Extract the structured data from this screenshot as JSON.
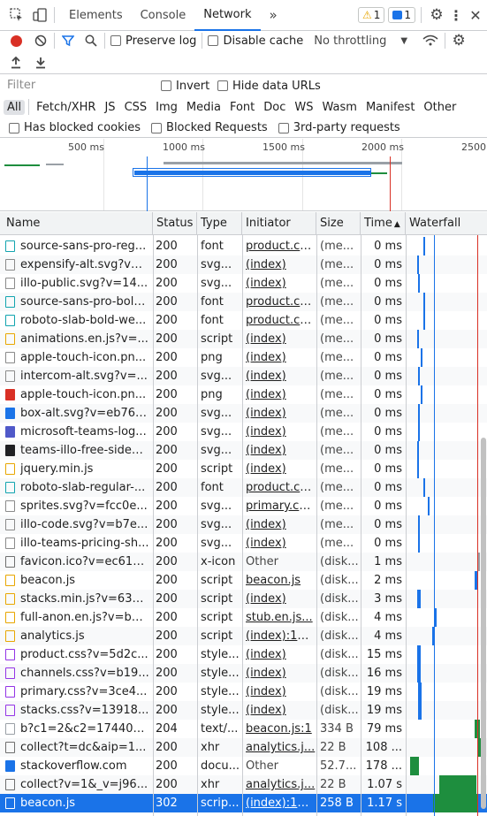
{
  "tabs": [
    "Elements",
    "Console",
    "Network"
  ],
  "more_tabs": "»",
  "warnings_count": "1",
  "messages_count": "1",
  "toolbar": {
    "preserve_log": "Preserve log",
    "disable_cache": "Disable cache",
    "throttling": "No throttling"
  },
  "filter": {
    "placeholder": "Filter",
    "invert": "Invert",
    "hide_data_urls": "Hide data URLs"
  },
  "type_filters": [
    "All",
    "Fetch/XHR",
    "JS",
    "CSS",
    "Img",
    "Media",
    "Font",
    "Doc",
    "WS",
    "Wasm",
    "Manifest",
    "Other"
  ],
  "options": {
    "blocked_cookies": "Has blocked cookies",
    "blocked_requests": "Blocked Requests",
    "third_party": "3rd-party requests"
  },
  "overview_ticks": [
    "500 ms",
    "1000 ms",
    "1500 ms",
    "2000 ms",
    "2500"
  ],
  "columns": {
    "name": "Name",
    "status": "Status",
    "type": "Type",
    "initiator": "Initiator",
    "size": "Size",
    "time": "Time",
    "waterfall": "Waterfall"
  },
  "rows": [
    {
      "name": "source-sans-pro-reg...",
      "status": "200",
      "type": "font",
      "initiator": "product.cs...",
      "size": "(me...",
      "time": "0 ms",
      "icon": "font"
    },
    {
      "name": "expensify-alt.svg?v=...",
      "status": "200",
      "type": "svg...",
      "initiator": "(index)",
      "size": "(me...",
      "time": "0 ms",
      "icon": "image"
    },
    {
      "name": "illo-public.svg?v=14...",
      "status": "200",
      "type": "svg...",
      "initiator": "(index)",
      "size": "(me...",
      "time": "0 ms",
      "icon": "image"
    },
    {
      "name": "source-sans-pro-bold...",
      "status": "200",
      "type": "font",
      "initiator": "product.cs...",
      "size": "(me...",
      "time": "0 ms",
      "icon": "font"
    },
    {
      "name": "roboto-slab-bold-we...",
      "status": "200",
      "type": "font",
      "initiator": "product.cs...",
      "size": "(me...",
      "time": "0 ms",
      "icon": "font"
    },
    {
      "name": "animations.en.js?v=...",
      "status": "200",
      "type": "script",
      "initiator": "(index)",
      "size": "(me...",
      "time": "0 ms",
      "icon": "script"
    },
    {
      "name": "apple-touch-icon.pn...",
      "status": "200",
      "type": "png",
      "initiator": "(index)",
      "size": "(me...",
      "time": "0 ms",
      "icon": "image"
    },
    {
      "name": "intercom-alt.svg?v=...",
      "status": "200",
      "type": "svg...",
      "initiator": "(index)",
      "size": "(me...",
      "time": "0 ms",
      "icon": "image"
    },
    {
      "name": "apple-touch-icon.pn...",
      "status": "200",
      "type": "png",
      "initiator": "(index)",
      "size": "(me...",
      "time": "0 ms",
      "icon": "red"
    },
    {
      "name": "box-alt.svg?v=eb76f...",
      "status": "200",
      "type": "svg...",
      "initiator": "(index)",
      "size": "(me...",
      "time": "0 ms",
      "icon": "box"
    },
    {
      "name": "microsoft-teams-log...",
      "status": "200",
      "type": "svg...",
      "initiator": "(index)",
      "size": "(me...",
      "time": "0 ms",
      "icon": "teams"
    },
    {
      "name": "teams-illo-free-sideb...",
      "status": "200",
      "type": "svg...",
      "initiator": "(index)",
      "size": "(me...",
      "time": "0 ms",
      "icon": "dark"
    },
    {
      "name": "jquery.min.js",
      "status": "200",
      "type": "script",
      "initiator": "(index)",
      "size": "(me...",
      "time": "0 ms",
      "icon": "script"
    },
    {
      "name": "roboto-slab-regular-...",
      "status": "200",
      "type": "font",
      "initiator": "product.cs...",
      "size": "(me...",
      "time": "0 ms",
      "icon": "font"
    },
    {
      "name": "sprites.svg?v=fcc0e...",
      "status": "200",
      "type": "svg...",
      "initiator": "primary.cs...",
      "size": "(me...",
      "time": "0 ms",
      "icon": "image"
    },
    {
      "name": "illo-code.svg?v=b7e...",
      "status": "200",
      "type": "svg...",
      "initiator": "(index)",
      "size": "(me...",
      "time": "0 ms",
      "icon": "image"
    },
    {
      "name": "illo-teams-pricing-sh...",
      "status": "200",
      "type": "svg...",
      "initiator": "(index)",
      "size": "(me...",
      "time": "0 ms",
      "icon": "image"
    },
    {
      "name": "favicon.ico?v=ec617...",
      "status": "200",
      "type": "x-icon",
      "initiator": "Other",
      "size": "(disk...",
      "time": "1 ms",
      "icon": "doc"
    },
    {
      "name": "beacon.js",
      "status": "200",
      "type": "script",
      "initiator": "beacon.js",
      "size": "(disk...",
      "time": "2 ms",
      "icon": "script"
    },
    {
      "name": "stacks.min.js?v=636...",
      "status": "200",
      "type": "script",
      "initiator": "(index)",
      "size": "(disk...",
      "time": "3 ms",
      "icon": "script"
    },
    {
      "name": "full-anon.en.js?v=b9...",
      "status": "200",
      "type": "script",
      "initiator": "stub.en.js...",
      "size": "(disk...",
      "time": "4 ms",
      "icon": "script"
    },
    {
      "name": "analytics.js",
      "status": "200",
      "type": "script",
      "initiator": "(index):17...",
      "size": "(disk...",
      "time": "4 ms",
      "icon": "script"
    },
    {
      "name": "product.css?v=5d2c...",
      "status": "200",
      "type": "style...",
      "initiator": "(index)",
      "size": "(disk...",
      "time": "15 ms",
      "icon": "css"
    },
    {
      "name": "channels.css?v=b19...",
      "status": "200",
      "type": "style...",
      "initiator": "(index)",
      "size": "(disk...",
      "time": "16 ms",
      "icon": "css"
    },
    {
      "name": "primary.css?v=3ce4...",
      "status": "200",
      "type": "style...",
      "initiator": "(index)",
      "size": "(disk...",
      "time": "19 ms",
      "icon": "css"
    },
    {
      "name": "stacks.css?v=13918...",
      "status": "200",
      "type": "style...",
      "initiator": "(index)",
      "size": "(disk...",
      "time": "19 ms",
      "icon": "css"
    },
    {
      "name": "b?c1=2&c2=174405...",
      "status": "204",
      "type": "text/...",
      "initiator": "beacon.js:1",
      "size": "334 B",
      "time": "79 ms",
      "icon": "gray"
    },
    {
      "name": "collect?t=dc&aip=1...",
      "status": "200",
      "type": "xhr",
      "initiator": "analytics.j...",
      "size": "22 B",
      "time": "108 ...",
      "icon": "doc"
    },
    {
      "name": "stackoverflow.com",
      "status": "200",
      "type": "docu...",
      "initiator": "Other",
      "size": "52.7...",
      "time": "178 ...",
      "icon": "blue"
    },
    {
      "name": "collect?v=1&_v=j96...",
      "status": "200",
      "type": "xhr",
      "initiator": "analytics.j...",
      "size": "22 B",
      "time": "1.07 s",
      "icon": "doc"
    },
    {
      "name": "beacon.js",
      "status": "302",
      "type": "scrip...",
      "initiator": "(index):17...",
      "size": "258 B",
      "time": "1.17 s",
      "icon": "script"
    }
  ]
}
